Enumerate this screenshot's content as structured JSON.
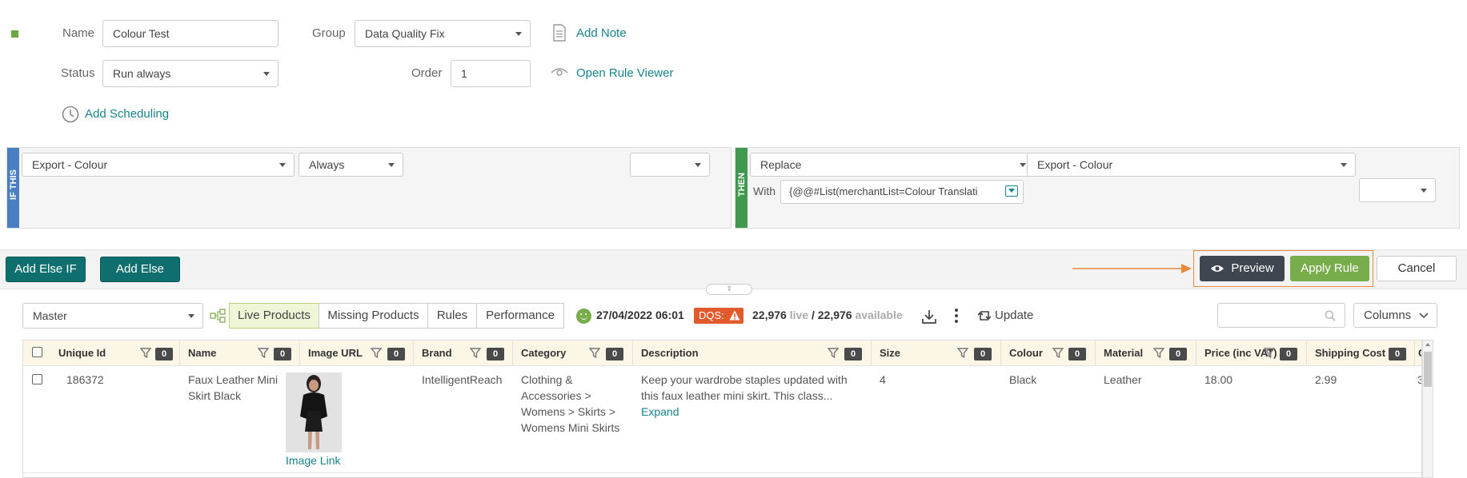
{
  "form": {
    "name_label": "Name",
    "name_value": "Colour Test",
    "group_label": "Group",
    "group_value": "Data Quality Fix",
    "add_note": "Add Note",
    "status_label": "Status",
    "status_value": "Run always",
    "order_label": "Order",
    "order_value": "1",
    "open_rule_viewer": "Open Rule Viewer",
    "add_scheduling": "Add Scheduling"
  },
  "if_block": {
    "tag": "IF THIS",
    "field": "Export - Colour",
    "operator": "Always",
    "extra": ""
  },
  "then_block": {
    "tag": "THEN",
    "action": "Replace",
    "field": "Export - Colour",
    "with_label": "With",
    "with_value": "{@@#List(merchantList=Colour Translati",
    "extra": ""
  },
  "actions": {
    "add_else_if": "Add Else IF",
    "add_else": "Add Else",
    "preview": "Preview",
    "apply_rule": "Apply Rule",
    "cancel": "Cancel"
  },
  "toolbar": {
    "catalog": "Master",
    "tabs": [
      "Live Products",
      "Missing Products",
      "Rules",
      "Performance"
    ],
    "timestamp": "27/04/2022 06:01",
    "dqs": "DQS:",
    "live_count": "22,976",
    "live_word": "live",
    "sep": "/",
    "available_count": "22,976",
    "available_word": "available",
    "update": "Update",
    "search_placeholder": "",
    "columns": "Columns"
  },
  "table": {
    "headers": [
      {
        "label": "Unique Id",
        "count": "0"
      },
      {
        "label": "Name",
        "count": "0"
      },
      {
        "label": "Image URL",
        "count": "0"
      },
      {
        "label": "Brand",
        "count": "0"
      },
      {
        "label": "Category",
        "count": "0"
      },
      {
        "label": "Description",
        "count": "0"
      },
      {
        "label": "Size",
        "count": "0"
      },
      {
        "label": "Colour",
        "count": "0"
      },
      {
        "label": "Material",
        "count": "0"
      },
      {
        "label": "Price (inc VAT)",
        "count": "0"
      },
      {
        "label": "Shipping Cost",
        "count": "0"
      },
      {
        "label": "C",
        "count": ""
      }
    ],
    "row": {
      "unique_id": "186372",
      "name": "Faux Leather Mini Skirt Black",
      "image_link": "Image Link",
      "brand": "IntelligentReach",
      "category": "Clothing & Accessories > Womens > Skirts > Womens Mini Skirts",
      "description": "Keep your wardrobe staples updated with this faux leather mini skirt. This class...",
      "expand": "Expand",
      "size": "4",
      "colour": "Black",
      "material": "Leather",
      "price": "18.00",
      "shipping": "2.99",
      "extra": "3"
    }
  },
  "colors": {
    "teal": "#0f6e6e",
    "link": "#17848c",
    "green": "#78ad4c",
    "orange_highlight": "#e8893a",
    "dqs_red": "#e05a2b",
    "if_blue": "#4a7fc1",
    "then_green": "#3f9a4f"
  }
}
